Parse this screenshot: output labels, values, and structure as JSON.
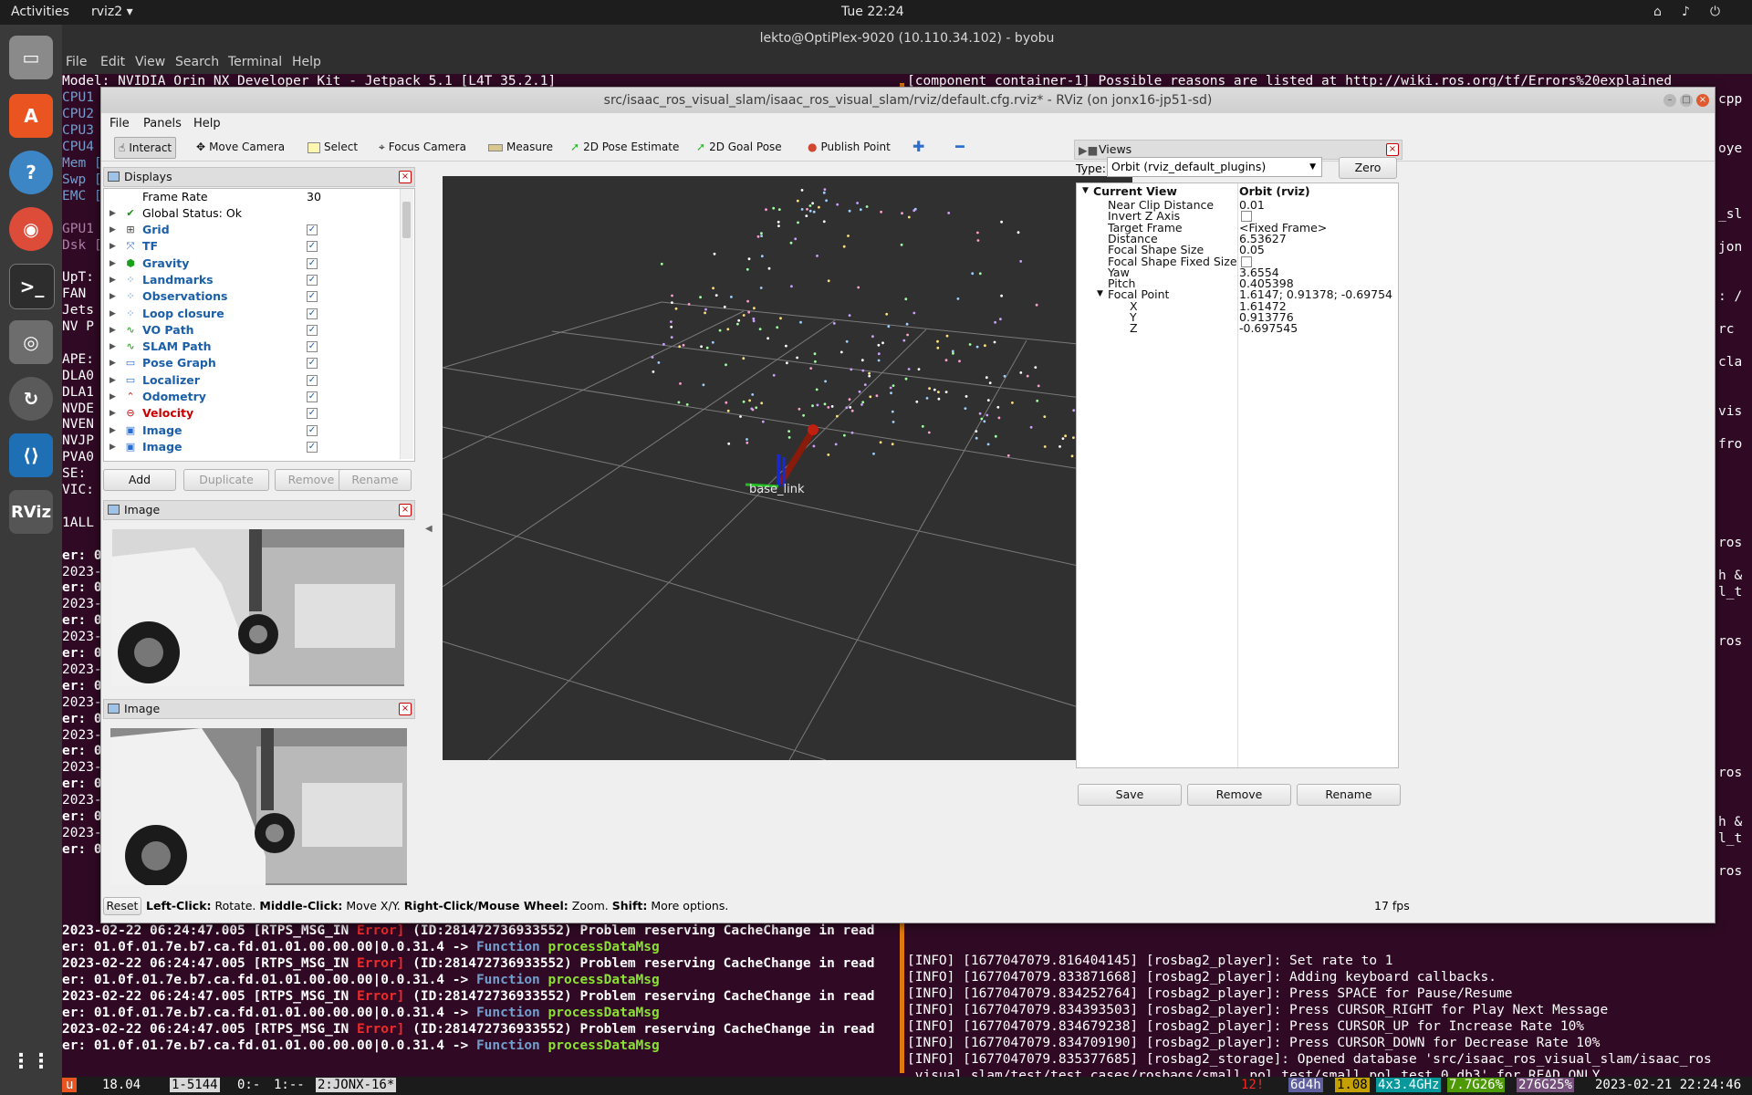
{
  "topbar": {
    "activities": "Activities",
    "app_menu": "rviz2 ▾",
    "clock": "Tue 22:24"
  },
  "terminal": {
    "title": "lekto@OptiPlex-9020 (10.110.34.102) - byobu",
    "menu": [
      "File",
      "Edit",
      "View",
      "Search",
      "Terminal",
      "Help"
    ],
    "left_lines": [
      {
        "t": "Model: NVIDIA Orin NX Developer Kit - Jetpack 5.1 [L4T 35.2.1]",
        "c": "w"
      },
      {
        "t": "CPU1",
        "c": "b"
      },
      {
        "t": "CPU2",
        "c": "b"
      },
      {
        "t": "CPU3",
        "c": "b"
      },
      {
        "t": "CPU4",
        "c": "b"
      }
    ],
    "left_side_labels": [
      "Mem [",
      "Swp [",
      "EMC [",
      "",
      "GPU1",
      "Dsk [",
      "",
      "UpT:",
      "FAN",
      "Jets",
      "NV P",
      "",
      "APE:",
      "DLA0",
      "DLA1",
      "NVDE",
      "NVEN",
      "NVJP",
      "PVA0",
      "SE:",
      "VIC:",
      "",
      "1ALL",
      "",
      "er: 0",
      "2023-",
      "er: 0",
      "2023-",
      "er: 0",
      "2023-",
      "er: 0",
      "2023-",
      "er: 0",
      "2023-",
      "er: 0",
      "2023-",
      "er: 0",
      "2023-",
      "er: 0",
      "2023-",
      "er: 0",
      "2023-",
      "er: 0"
    ],
    "right_top": "[component_container-1] Possible reasons are listed at http://wiki.ros.org/tf/Errors%20explained",
    "right_side_labels": [
      "cpp",
      "",
      "",
      "oye",
      "",
      "",
      "",
      "_sl",
      "",
      "jon",
      "",
      "",
      ": /",
      "",
      "rc",
      "",
      "cla",
      "",
      "",
      "vis",
      "",
      "fro",
      "",
      "",
      "",
      "",
      "",
      "ros",
      "",
      "h &",
      "l_t",
      "",
      "",
      "ros",
      "",
      "",
      "",
      "",
      "",
      "",
      "",
      "ros",
      "",
      "",
      "h &",
      "l_t",
      "",
      "ros"
    ],
    "bottom_left": [
      {
        "ts": "2023-02-22 06:24:47.005",
        "tag": "[RTPS_MSG_IN",
        "err": "Error]",
        "msg": "(ID:281472736933552) Problem reserving CacheChange in read"
      },
      {
        "ts": "er: 01.0f.01.7e.b7.ca.fd.01.01.00.00.00|0.0.31.4 ->",
        "fn": "Function",
        "fname": "processDataMsg"
      }
    ],
    "bottom_right": [
      "[INFO] [1677047079.816404145] [rosbag2_player]: Set rate to 1",
      "[INFO] [1677047079.833871668] [rosbag2_player]: Adding keyboard callbacks.",
      "[INFO] [1677047079.834252764] [rosbag2_player]: Press SPACE for Pause/Resume",
      "[INFO] [1677047079.834393503] [rosbag2_player]: Press CURSOR_RIGHT for Play Next Message",
      "[INFO] [1677047079.834679238] [rosbag2_player]: Press CURSOR_UP for Increase Rate 10%",
      "[INFO] [1677047079.834709190] [rosbag2_player]: Press CURSOR_DOWN for Decrease Rate 10%",
      "[INFO] [1677047079.835377685] [rosbag2_storage]: Opened database 'src/isaac_ros_visual_slam/isaac_ros",
      "_visual_slam/test/test_cases/rosbags/small_pol_test/small_pol_test_0.db3' for READ_ONLY."
    ],
    "status": {
      "u": "u",
      "load": "18.04",
      "win1": "1-5144",
      "win2": "0:-",
      "win3": "1:--",
      "win4": "2:JONX-16*",
      "alerts": "12!",
      "uptime": "6d4h",
      "loadavg": "1.08",
      "cpu": "4x3.4GHz",
      "mem": "7.7G26%",
      "disk": "276G25%",
      "datetime": "2023-02-21 22:24:46"
    }
  },
  "rviz": {
    "title": "src/isaac_ros_visual_slam/isaac_ros_visual_slam/rviz/default.cfg.rviz* - RViz (on jonx16-jp51-sd)",
    "menu": [
      "File",
      "Panels",
      "Help"
    ],
    "tools": [
      "Interact",
      "Move Camera",
      "Select",
      "Focus Camera",
      "Measure",
      "2D Pose Estimate",
      "2D Goal Pose",
      "Publish Point"
    ],
    "displays": {
      "title": "Displays",
      "frame_rate_label": "Frame Rate",
      "frame_rate": "30",
      "global_status": "Global Status: Ok",
      "items": [
        {
          "label": "Grid",
          "color": "#1a5fa8",
          "icon": "grid-icon"
        },
        {
          "label": "TF",
          "color": "#1a5fa8",
          "icon": "tf-icon"
        },
        {
          "label": "Gravity",
          "color": "#1a5fa8",
          "icon": "gravity-icon"
        },
        {
          "label": "Landmarks",
          "color": "#1a5fa8",
          "icon": "points-icon"
        },
        {
          "label": "Observations",
          "color": "#1a5fa8",
          "icon": "points-icon"
        },
        {
          "label": "Loop closure",
          "color": "#1a5fa8",
          "icon": "points-icon"
        },
        {
          "label": "VO Path",
          "color": "#1a5fa8",
          "icon": "path-icon"
        },
        {
          "label": "SLAM Path",
          "color": "#1a5fa8",
          "icon": "path-icon"
        },
        {
          "label": "Pose Graph",
          "color": "#1a5fa8",
          "icon": "folder-icon"
        },
        {
          "label": "Localizer",
          "color": "#1a5fa8",
          "icon": "folder-icon"
        },
        {
          "label": "Odometry",
          "color": "#1a5fa8",
          "icon": "odometry-icon"
        },
        {
          "label": "Velocity",
          "color": "#cc0000",
          "icon": "error-icon"
        },
        {
          "label": "Image",
          "color": "#1a5fa8",
          "icon": "image-icon"
        },
        {
          "label": "Image",
          "color": "#1a5fa8",
          "icon": "image-icon"
        }
      ],
      "buttons": {
        "add": "Add",
        "duplicate": "Duplicate",
        "remove": "Remove",
        "rename": "Rename"
      }
    },
    "image_panels": [
      "Image",
      "Image"
    ],
    "viewport": {
      "frame_label": "base_link"
    },
    "views": {
      "title": "Views",
      "type_label": "Type:",
      "type_value": "Orbit (rviz_default_plugins)",
      "zero": "Zero",
      "current_view": "Current View",
      "current_view_value": "Orbit (rviz)",
      "props": [
        {
          "k": "Near Clip Distance",
          "v": "0.01"
        },
        {
          "k": "Invert Z Axis",
          "v": ""
        },
        {
          "k": "Target Frame",
          "v": "<Fixed Frame>"
        },
        {
          "k": "Distance",
          "v": "6.53627"
        },
        {
          "k": "Focal Shape Size",
          "v": "0.05"
        },
        {
          "k": "Focal Shape Fixed Size",
          "v": ""
        },
        {
          "k": "Yaw",
          "v": "3.6554"
        },
        {
          "k": "Pitch",
          "v": "0.405398"
        },
        {
          "k": "Focal Point",
          "v": "1.6147; 0.91378; -0.69754"
        },
        {
          "k": "X",
          "v": "1.61472"
        },
        {
          "k": "Y",
          "v": "0.913776"
        },
        {
          "k": "Z",
          "v": "-0.697545"
        }
      ],
      "buttons": {
        "save": "Save",
        "remove": "Remove",
        "rename": "Rename"
      }
    },
    "statusbar": {
      "reset": "Reset",
      "hint_parts": [
        "Left-Click:",
        " Rotate. ",
        "Middle-Click:",
        " Move X/Y. ",
        "Right-Click/Mouse Wheel:",
        " Zoom. ",
        "Shift:",
        " More options."
      ],
      "fps": "17 fps"
    }
  }
}
